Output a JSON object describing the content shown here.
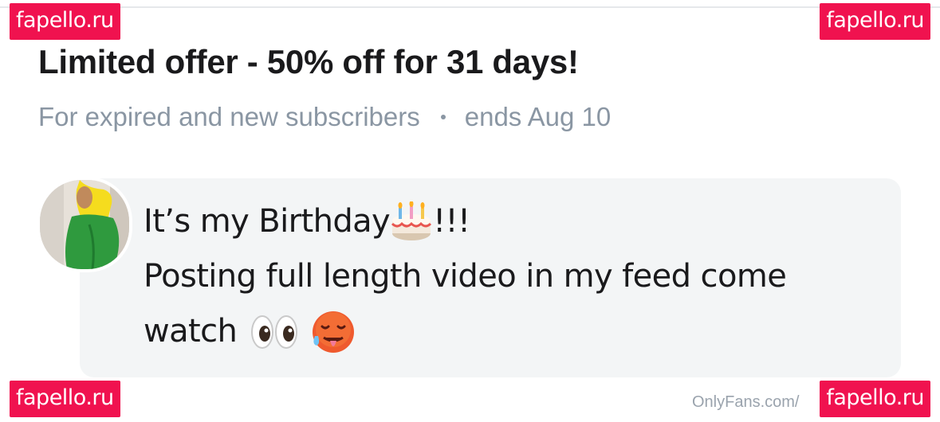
{
  "watermarks": {
    "top_left": "fapello.ru",
    "top_right": "fapello.ru",
    "bottom_left": "fapello.ru",
    "bottom_right": "fapello.ru"
  },
  "offer": {
    "title": "Limited offer - 50% off for 31 days!",
    "audience": "For expired and new subscribers",
    "ends": "ends Aug 10"
  },
  "message": {
    "line1_text": "It’s my Birthday",
    "line1_suffix": "!!!",
    "line2": "Posting full length video in my feed come",
    "line3": "watch",
    "emojis": [
      "birthday-cake-emoji",
      "eyes-emoji",
      "hot-face-emoji"
    ]
  },
  "footer": {
    "site_caption": "OnlyFans.com/"
  },
  "colors": {
    "watermark": "#f0124f",
    "muted_text": "#8a96a3",
    "bubble_bg": "#f3f5f6"
  }
}
